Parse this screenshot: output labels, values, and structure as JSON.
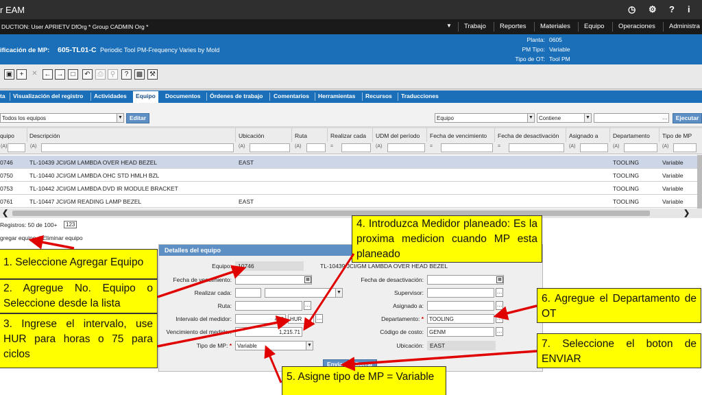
{
  "app": {
    "title": "r EAM",
    "icons": [
      "clock-icon",
      "gear-icon",
      "help-icon",
      "info-icon"
    ]
  },
  "nav": {
    "user": "DUCTION: User APRIETV DfOrg * Group CADMIN Org *",
    "menu": [
      "Trabajo",
      "Reportes",
      "Materiales",
      "Equipo",
      "Operaciones",
      "Administra"
    ]
  },
  "header": {
    "label": "ificación de MP:",
    "code": "605-TL01-C",
    "desc": "Periodic Tool PM-Frequency Varies by Mold",
    "fields": [
      {
        "k": "Planta:",
        "v": "0605"
      },
      {
        "k": "PM Tipo:",
        "v": "Variable"
      },
      {
        "k": "Tipo de OT:",
        "v": "Tool PM"
      }
    ]
  },
  "tabs": [
    "ta",
    "Visualización del registro",
    "Actividades",
    "Equipo",
    "Documentos",
    "Órdenes de trabajo",
    "Comentarios",
    "Herramientas",
    "Recursos",
    "Traducciones"
  ],
  "filter": {
    "dataspy": "Todos los equipos",
    "edit": "Editar",
    "field": "Equipo",
    "op": "Contiene",
    "value": "",
    "run": "Ejecutar"
  },
  "grid": {
    "columns": [
      "quipo",
      "Descripción",
      "Ubicación",
      "Ruta",
      "Realizar cada",
      "UDM del período",
      "Fecha de vencimiento",
      "Fecha de desactivación",
      "Asignado a",
      "Departamento",
      "Tipo de MP"
    ],
    "rows": [
      {
        "id": "0746",
        "desc": "TL-10439 JCI/GM LAMBDA OVER HEAD BEZEL",
        "loc": "EAST",
        "dept": "TOOLING",
        "type": "Variable"
      },
      {
        "id": "0750",
        "desc": "TL-10440 JCI/GM LAMBDA OHC STD HMLH BZL",
        "loc": "",
        "dept": "TOOLING",
        "type": "Variable"
      },
      {
        "id": "0753",
        "desc": "TL-10442 JCI/GM LAMBDA DVD IR MODULE BRACKET",
        "loc": "",
        "dept": "TOOLING",
        "type": "Variable"
      },
      {
        "id": "0761",
        "desc": "TL-10447 JCI/GM READING LAMP BEZEL",
        "loc": "EAST",
        "dept": "TOOLING",
        "type": "Variable"
      }
    ],
    "records": "Registros: 50 de 100+",
    "records_badge": "123"
  },
  "actions": {
    "add": "gregar equipo",
    "sep": "|",
    "remove": "Eliminar equipo"
  },
  "details": {
    "title": "Detalles del equipo",
    "equipo_label": "Equipo:",
    "equipo": "10746",
    "equipo_desc": "TL-10439 JCI/GM LAMBDA OVER HEAD BEZEL",
    "venc_label": "Fecha de vencimiento:",
    "desact_label": "Fecha de desactivación:",
    "realizar_label": "Realizar cada:",
    "supervisor_label": "Supervisor:",
    "ruta_label": "Ruta:",
    "asignado_label": "Asignado a:",
    "intervalo_label": "Intervalo del medidor:",
    "intervalo": "400",
    "intervalo_udm": "HUR",
    "depto_label": "Departamento:",
    "depto": "TOOLING",
    "venc_med_label": "Vencimiento del medidor:",
    "venc_med": "1,215.71",
    "costo_label": "Código de costo:",
    "costo": "GENM",
    "tipo_label": "Tipo de MP:",
    "tipo": "Variable",
    "ubic_label": "Ubicación:",
    "ubic": "EAST",
    "send": "Enviar",
    "clear": "Borrar"
  },
  "callouts": {
    "c1": "1. Seleccione Agregar Equipo",
    "c2": "2. Agregue No. Equipo o Seleccione desde la lista",
    "c3": "3. Ingrese el intervalo, use HUR para horas o 75 para ciclos",
    "c4": "4. Introduzca Medidor planeado: Es la proxima medicion cuando MP esta planeado",
    "c5": "5. Asigne tipo de MP = Variable",
    "c6": "6. Agregue el Departamento de OT",
    "c7": "7. Seleccione el boton de ENVIAR"
  },
  "colors": {
    "accent": "#1a6fb8",
    "callout": "#ffff00",
    "arrow": "#e00000"
  }
}
